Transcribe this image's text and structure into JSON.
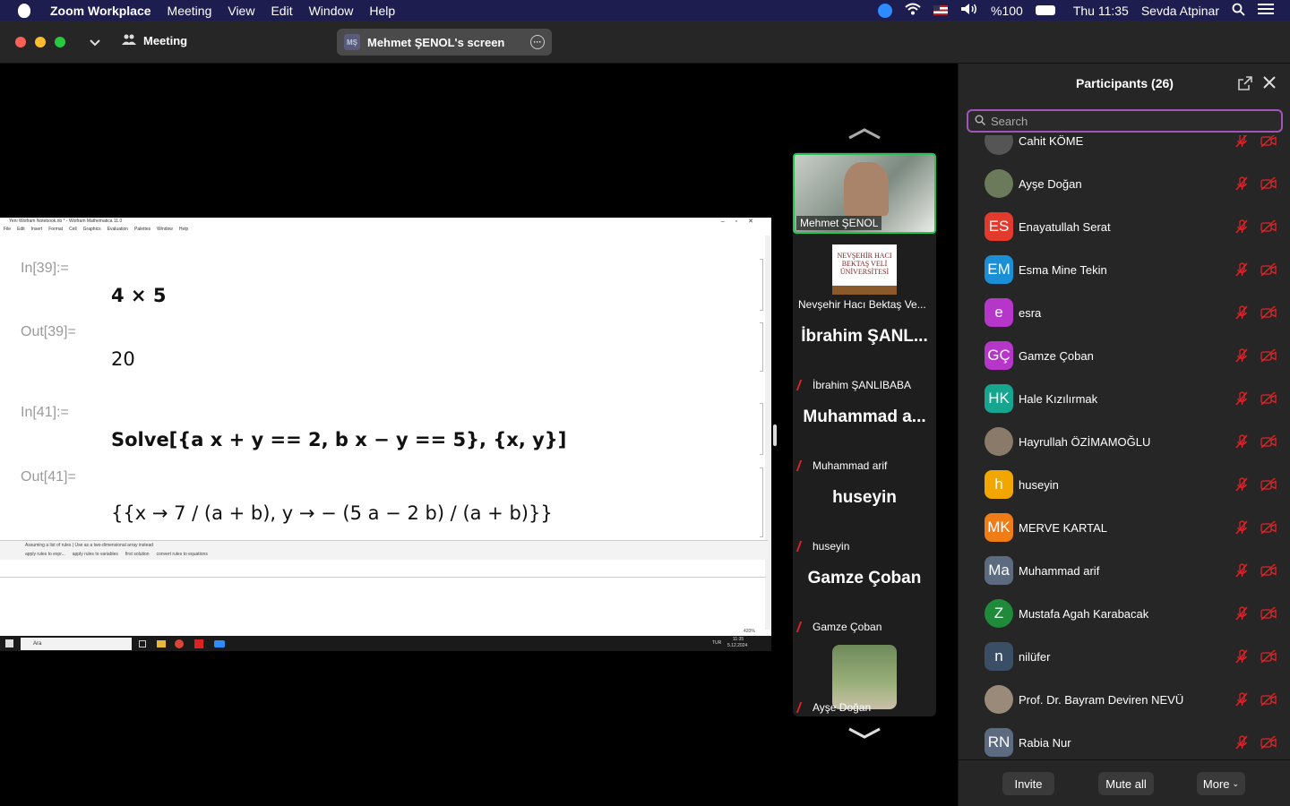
{
  "menubar": {
    "app": "Zoom Workplace",
    "items": [
      "Meeting",
      "View",
      "Edit",
      "Window",
      "Help"
    ],
    "battery": "%100",
    "clock": "Thu 11:35",
    "user": "Sevda Atpinar"
  },
  "titlebar": {
    "meeting_label": "Meeting",
    "screen_pill_initials": "MŞ",
    "screen_pill_label": "Mehmet ŞENOL's screen"
  },
  "share": {
    "window_title": "Yeni Wolfram Notebook.nb * - Wolfram Mathematica 11.0",
    "menu": [
      "File",
      "Edit",
      "Insert",
      "Format",
      "Cell",
      "Graphics",
      "Evaluation",
      "Palettes",
      "Window",
      "Help"
    ],
    "cells": [
      {
        "label": "In[39]:=",
        "expr": "4 × 5"
      },
      {
        "label": "Out[39]=",
        "expr": "20"
      },
      {
        "label": "In[41]:=",
        "expr": "Solve[{a x + y == 2, b x − y == 5}, {x, y}]"
      },
      {
        "label": "Out[41]=",
        "expr": "{{x → 7 / (a + b), y → − (5 a − 2 b) / (a + b)}}"
      }
    ],
    "assist_note": "Assuming a list of rules | Use as a two-dimensional array instead",
    "assist_buttons": [
      "apply rules to expr...",
      "apply rules to variables",
      "first solution",
      "convert rules to equations"
    ],
    "zoom": "420%",
    "taskbar_search": "Ara",
    "taskbar_lang": "TUR",
    "taskbar_time": "11:35",
    "taskbar_date": "5.12.2024"
  },
  "thumbnails": [
    {
      "big": "",
      "name": "Mehmet ŞENOL",
      "muted": false,
      "active": true
    },
    {
      "big": "",
      "name": "Nevşehir Hacı Bektaş Ve...",
      "muted": false,
      "active": false
    },
    {
      "big": "İbrahim ŞANL...",
      "name": "İbrahim ŞANLIBABA",
      "muted": true,
      "active": false
    },
    {
      "big": "Muhammad a...",
      "name": "Muhammad arif",
      "muted": true,
      "active": false
    },
    {
      "big": "huseyin",
      "name": "huseyin",
      "muted": true,
      "active": false
    },
    {
      "big": "Gamze Çoban",
      "name": "Gamze Çoban",
      "muted": true,
      "active": false
    },
    {
      "big": "",
      "name": "Ayşe Doğan",
      "muted": true,
      "active": false
    }
  ],
  "logo_text": "NEVŞEHİR HACI BEKTAŞ VELİ ÜNİVERSİTESİ",
  "panel": {
    "title": "Participants (26)",
    "search_placeholder": "Search",
    "participants": [
      {
        "name": "Cahit KÖME",
        "initials": "",
        "color": "#555555",
        "photo": true
      },
      {
        "name": "Ayşe Doğan",
        "initials": "",
        "color": "#6a7a5a",
        "photo": true
      },
      {
        "name": "Enayatullah Serat",
        "initials": "ES",
        "color": "#e23b2e"
      },
      {
        "name": "Esma Mine Tekin",
        "initials": "EM",
        "color": "#1a8fd6"
      },
      {
        "name": "esra",
        "initials": "e",
        "color": "#b536c8"
      },
      {
        "name": "Gamze Çoban",
        "initials": "GÇ",
        "color": "#b536c8"
      },
      {
        "name": "Hale Kızılırmak",
        "initials": "HK",
        "color": "#16a58f"
      },
      {
        "name": "Hayrullah ÖZİMAMOĞLU",
        "initials": "",
        "color": "#8a7a6a",
        "photo": true
      },
      {
        "name": "huseyin",
        "initials": "h",
        "color": "#f2a600"
      },
      {
        "name": "MERVE KARTAL",
        "initials": "MK",
        "color": "#f07c15"
      },
      {
        "name": "Muhammad arif",
        "initials": "Ma",
        "color": "#5d6b80"
      },
      {
        "name": "Mustafa Agah Karabacak",
        "initials": "Z",
        "color": "#1e8a3a",
        "photo": true
      },
      {
        "name": "nilüfer",
        "initials": "n",
        "color": "#3a4e66"
      },
      {
        "name": "Prof. Dr. Bayram Deviren NEVÜ",
        "initials": "",
        "color": "#9a8a7a",
        "photo": true
      },
      {
        "name": "Rabia Nur",
        "initials": "RN",
        "color": "#5d6b80"
      }
    ],
    "invite": "Invite",
    "mute_all": "Mute all",
    "more": "More"
  },
  "colors": {
    "accent": "#a155b9",
    "muted_red": "#e0242a",
    "active_border": "#23c552"
  }
}
